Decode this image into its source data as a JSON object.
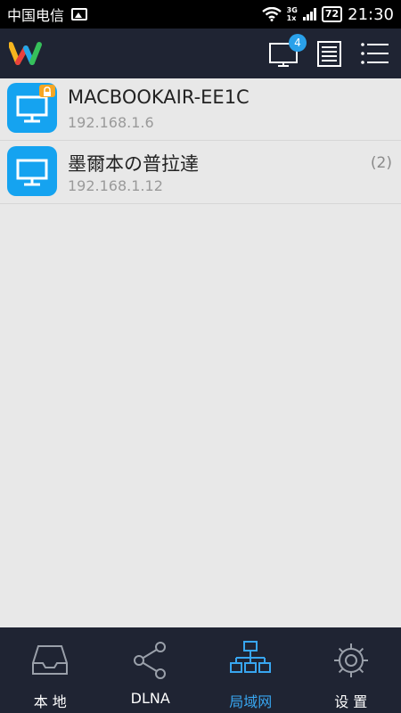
{
  "status_bar": {
    "carrier": "中国电信",
    "network": [
      "3G",
      "1x"
    ],
    "battery": "72",
    "time": "21:30"
  },
  "app_bar": {
    "notification_count": "4"
  },
  "devices": [
    {
      "name": "MACBOOKAIR-EE1C",
      "ip": "192.168.1.6",
      "locked": true,
      "count": ""
    },
    {
      "name": "墨爾本の普拉達",
      "ip": "192.168.1.12",
      "locked": false,
      "count": "(2)"
    }
  ],
  "bottom_nav": [
    {
      "label": "本 地",
      "icon": "inbox-icon",
      "active": false
    },
    {
      "label": "DLNA",
      "icon": "share-icon",
      "active": false
    },
    {
      "label": "局域网",
      "icon": "network-icon",
      "active": true
    },
    {
      "label": "设 置",
      "icon": "gear-icon",
      "active": false
    }
  ],
  "colors": {
    "bar_background": "#1f2433",
    "accent": "#38a6f0",
    "device_icon": "#15a3f0",
    "lock": "#f6a623"
  }
}
